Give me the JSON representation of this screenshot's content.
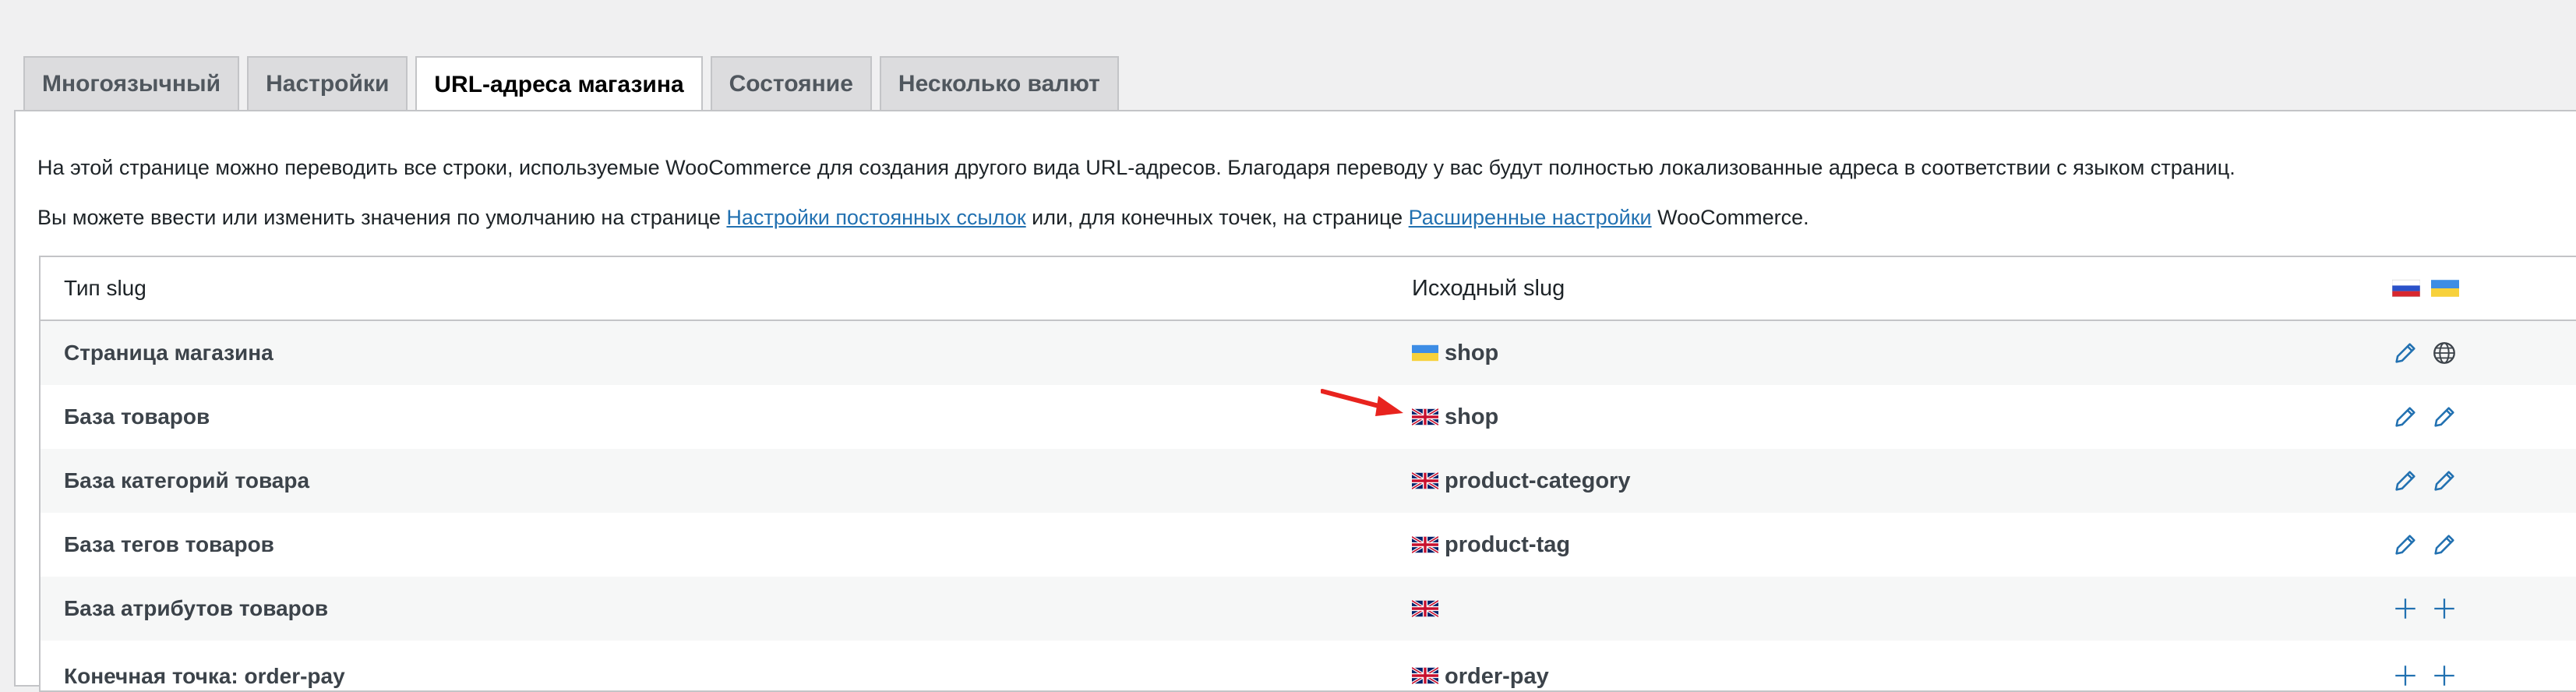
{
  "tabs": [
    {
      "label": "Многоязычный"
    },
    {
      "label": "Настройки"
    },
    {
      "label": "URL-адреса магазина",
      "active": true
    },
    {
      "label": "Состояние"
    },
    {
      "label": "Несколько валют"
    }
  ],
  "description": {
    "line1": "На этой странице можно переводить все строки, используемые WooCommerce для создания другого вида URL-адресов. Благодаря переводу у вас будут полностью локализованные адреса в соответствии с языком страниц.",
    "line2_part1": "Вы можете ввести или изменить значения по умолчанию на странице ",
    "line2_link1": "Настройки постоянных ссылок",
    "line2_part2": " или, для конечных точек, на странице ",
    "line2_link2": "Расширенные настройки",
    "line2_part3": " WooCommerce."
  },
  "table": {
    "headers": {
      "slug_type": "Тип slug",
      "original_slug": "Исходный slug"
    },
    "header_flags": [
      "flag-russia-icon",
      "flag-ukraine-icon"
    ],
    "rows": [
      {
        "type": "Страница магазина",
        "flag": "flag-ukraine-icon",
        "slug": "shop",
        "actions": [
          "pencil-icon",
          "globe-icon"
        ]
      },
      {
        "type": "База товаров",
        "flag": "flag-uk-icon",
        "slug": "shop",
        "actions": [
          "pencil-icon",
          "pencil-icon"
        ]
      },
      {
        "type": "База категорий товара",
        "flag": "flag-uk-icon",
        "slug": "product-category",
        "actions": [
          "pencil-icon",
          "pencil-icon"
        ]
      },
      {
        "type": "База тегов товаров",
        "flag": "flag-uk-icon",
        "slug": "product-tag",
        "actions": [
          "pencil-icon",
          "pencil-icon"
        ]
      },
      {
        "type": "База атрибутов товаров",
        "flag": "flag-uk-icon",
        "slug": "",
        "actions": [
          "plus-icon",
          "plus-icon"
        ]
      },
      {
        "type": "Конечная точка: order-pay",
        "flag": "flag-uk-icon",
        "slug": "order-pay",
        "actions": [
          "plus-icon",
          "plus-icon"
        ]
      }
    ]
  },
  "annotation": {
    "icon": "red-arrow-icon",
    "color": "#e8231e"
  },
  "colors": {
    "link": "#2271b1",
    "action_icon": "#2271b1"
  }
}
